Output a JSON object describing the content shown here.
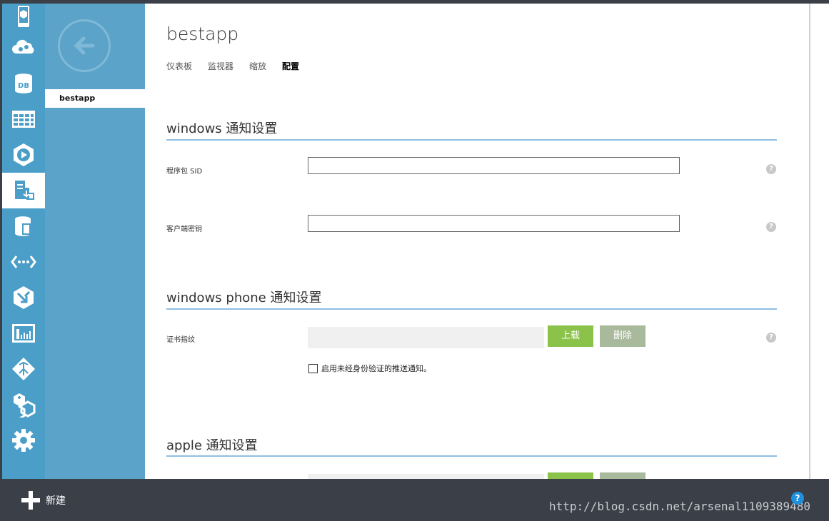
{
  "app": {
    "title": "bestapp"
  },
  "subnav": {
    "selected_item": "bestapp"
  },
  "tabs": [
    {
      "label": "仪表板",
      "active": false
    },
    {
      "label": "监视器",
      "active": false
    },
    {
      "label": "缩放",
      "active": false
    },
    {
      "label": "配置",
      "active": true
    }
  ],
  "windows_section": {
    "title": "windows 通知设置",
    "package_sid_label": "程序包 SID",
    "package_sid_value": "",
    "client_secret_label": "客户端密钥",
    "client_secret_value": ""
  },
  "windows_phone_section": {
    "title": "windows phone 通知设置",
    "cert_thumbprint_label": "证书指纹",
    "upload_label": "上载",
    "delete_label": "删除",
    "unauth_push_label": "启用未经身份验证的推送通知。",
    "unauth_push_checked": false
  },
  "apple_section": {
    "title": "apple 通知设置"
  },
  "help_glyph": "?",
  "bottombar": {
    "new_label": "新建",
    "help_glyph": "?",
    "watermark": "http://blog.csdn.net/arsenal1109389480"
  },
  "colors": {
    "rail": "#4a9ec7",
    "subnav": "#5ba3c8",
    "bottombar": "#3b3f48",
    "accent_line": "#8ec0e6",
    "upload_btn": "#8bc34a",
    "delete_btn": "#a9b99c"
  },
  "rail_icons": [
    "mobile-service-icon",
    "cloud-service-icon",
    "database-icon",
    "table-storage-icon",
    "media-services-icon",
    "mobile-services-active-icon",
    "sql-database-icon",
    "api-management-icon",
    "cache-icon",
    "web-dashboard-icon",
    "network-icon",
    "hexagons-icon",
    "settings-icon"
  ]
}
